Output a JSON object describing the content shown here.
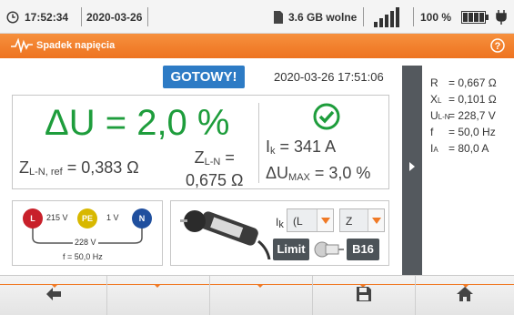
{
  "status": {
    "time": "17:52:34",
    "date": "2020-03-26",
    "storage": "3.6 GB wolne",
    "battery": "100 %"
  },
  "title": "Spadek napięcia",
  "status_label": "GOTOWY!",
  "result_datetime": "2020-03-26 17:51:06",
  "results": {
    "delta_u": "ΔU = 2,0 %",
    "zln_ref_prefix": "Z",
    "zln_ref_sub": "L-N, ref",
    "zln_ref_value": " = 0,383 Ω",
    "zln_prefix": "Z",
    "zln_sub": "L-N",
    "zln_suffix": " =",
    "zln_value": "0,675 Ω",
    "ik_prefix": "I",
    "ik_sub": "k",
    "ik_value": " = 341 A",
    "dumax_prefix": "ΔU",
    "dumax_sub": "MAX",
    "dumax_value": " = 3,0 %"
  },
  "side_results": [
    {
      "label": "R",
      "sub": "",
      "value": "= 0,667 Ω"
    },
    {
      "label": "X",
      "sub": "L",
      "value": "= 0,101 Ω"
    },
    {
      "label": "U",
      "sub": "L-N",
      "value": "= 228,7 V"
    },
    {
      "label": "f",
      "sub": "",
      "value": "= 50,0 Hz"
    },
    {
      "label": "I",
      "sub": "A",
      "value": "= 80,0 A"
    }
  ],
  "terminals": {
    "l": "L",
    "pe": "PE",
    "n": "N",
    "l_pe_voltage": "215 V",
    "pe_n_voltage": "1 V",
    "l_n_voltage": "228 V",
    "frequency": "f = 50,0 Hz"
  },
  "settings": {
    "ik_prefix": "I",
    "ik_sub": "k",
    "ik_option": "(L",
    "z_option": "Z",
    "limit_label": "Limit",
    "fuse_label": "B16"
  },
  "colors": {
    "accent": "#f07a26",
    "ok_green": "#1e9d3c",
    "ready_blue": "#2d7bc5",
    "l_red": "#c8202a",
    "pe_yellow": "#d8b800",
    "n_blue": "#1f4f9e"
  },
  "icons": {
    "clock": "clock-icon",
    "sd": "sd-card-icon",
    "signal": "signal-icon",
    "battery": "battery-icon",
    "plug": "plug-icon",
    "title": "waveform-icon",
    "help": "help-icon",
    "ok": "check-circle-icon",
    "back": "arrow-left-icon",
    "save": "save-icon",
    "home": "home-icon"
  }
}
